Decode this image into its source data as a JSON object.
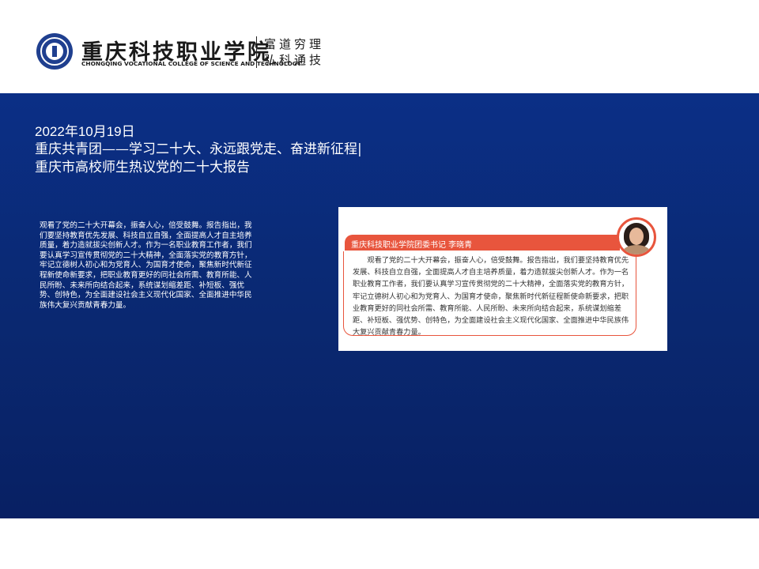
{
  "header": {
    "school_name_cn": "重庆科技职业学院",
    "school_name_en": "CHONGQING VOCATIONAL COLLEGE OF SCIENCE AND TECHNOLOGY",
    "motto_line1": "富道穷理",
    "motto_line2": "弘科通技"
  },
  "article": {
    "date": "2022年10月19日",
    "headline_line1": "重庆共青团——学习二十大、永远跟党走、奋进新征程|",
    "headline_line2": "重庆市高校师生热议党的二十大报告",
    "body": "观看了党的二十大开幕会，振奋人心，倍受鼓舞。报告指出，我们要坚持教育优先发展、科技自立自强，全面提高人才自主培养质量，着力造就拔尖创新人才。作为一名职业教育工作者，我们要认真学习宣传贯彻党的二十大精神，全面落实党的教育方针，牢记立德树人初心和为党育人、为国育才使命，聚焦新时代新征程新使命新要求，把职业教育更好的同社会所需、教育所能、人民所盼、未来所向结合起来，系统谋划缩差距、补短板、强优势、创特色，为全面建设社会主义现代化国家、全面推进中华民族伟大复兴贡献青春力量。"
  },
  "quote_card": {
    "speaker": "重庆科技职业学院团委书记 李晓青",
    "text": "观看了党的二十大开幕会，振奋人心，倍受鼓舞。报告指出，我们要坚持教育优先发展、科技自立自强，全面提高人才自主培养质量，着力造就拔尖创新人才。作为一名职业教育工作者，我们要认真学习宣传贯彻党的二十大精神，全面落实党的教育方针，牢记立德树人初心和为党育人、为国育才使命，聚焦新时代新征程新使命新要求，把职业教育更好的同社会所需、教育所能、人民所盼、未来所向结合起来，系统谋划缩差距、补短板、强优势、创特色，为全面建设社会主义现代化国家、全面推进中华民族伟大复兴贡献青春力量。"
  },
  "colors": {
    "banner_blue": "#0b2f86",
    "accent_red": "#e8553d"
  }
}
